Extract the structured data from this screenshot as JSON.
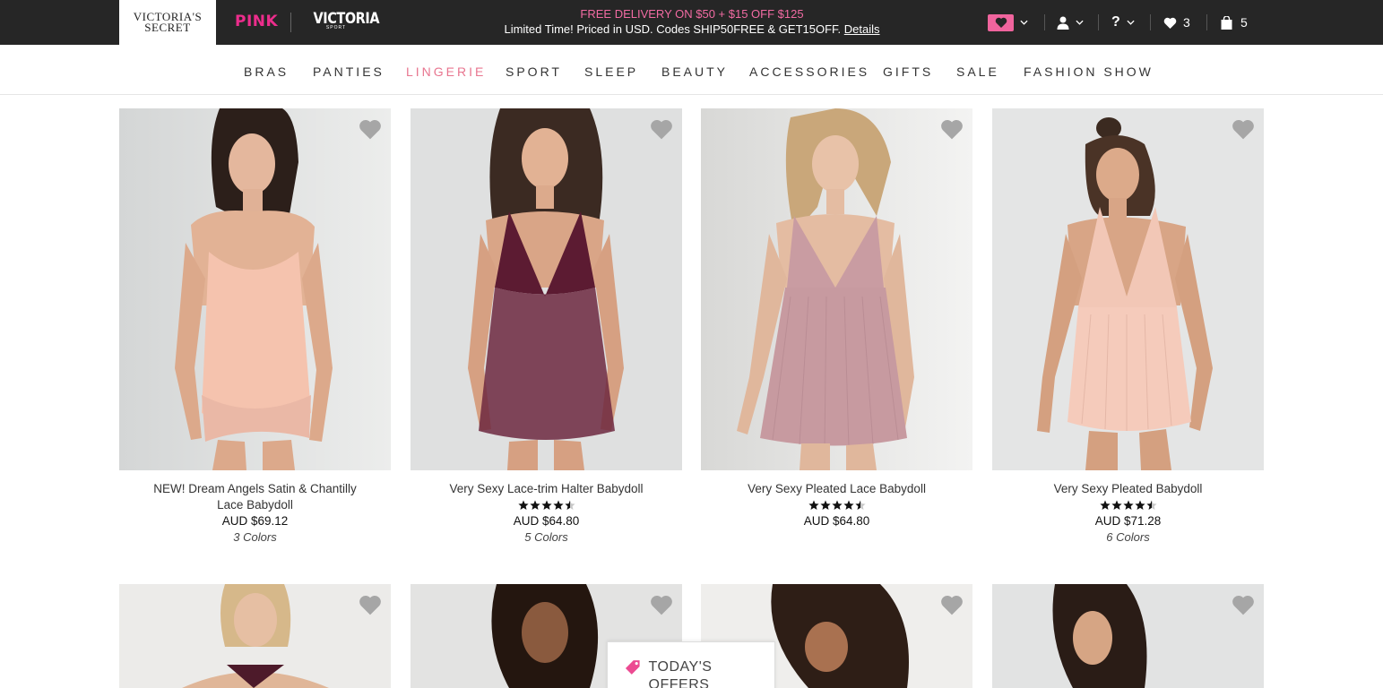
{
  "header": {
    "brand_vs_line1": "VICTORIA'S",
    "brand_vs_line2": "SECRET",
    "brand_pink": "PINK",
    "brand_sport_main": "VICTORIA",
    "brand_sport_sub": "SPORT",
    "promo_line1": "FREE DELIVERY ON $50 + $15 OFF $125",
    "promo_line2": "Limited Time! Priced in USD. Codes SHIP50FREE & GET15OFF.",
    "promo_details": "Details",
    "wishlist_count": "3",
    "bag_count": "5",
    "help_label": "?"
  },
  "nav": {
    "items": [
      "BRAS",
      "PANTIES",
      "LINGERIE",
      "SPORT",
      "SLEEP",
      "BEAUTY",
      "ACCESSORIES",
      "GIFTS",
      "SALE",
      "FASHION SHOW"
    ],
    "active": "LINGERIE"
  },
  "products": [
    {
      "name_line1": "NEW! Dream Angels Satin & Chantilly",
      "name_line2": "Lace Babydoll",
      "rating": 0,
      "price": "AUD $69.12",
      "colors": "3 Colors"
    },
    {
      "name_line1": "Very Sexy Lace-trim Halter Babydoll",
      "name_line2": "",
      "rating": 4.5,
      "price": "AUD $64.80",
      "colors": "5 Colors"
    },
    {
      "name_line1": "Very Sexy Pleated Lace Babydoll",
      "name_line2": "",
      "rating": 4.5,
      "price": "AUD $64.80",
      "colors": ""
    },
    {
      "name_line1": "Very Sexy Pleated Babydoll",
      "name_line2": "",
      "rating": 4.5,
      "price": "AUD $71.28",
      "colors": "6 Colors"
    }
  ],
  "offers": {
    "label": "TODAY'S OFFERS"
  },
  "colors": {
    "topbar_bg": "#262626",
    "pink_accent": "#ec2d8c",
    "promo_pink": "#f26ba3",
    "nav_active": "#e8758f",
    "heart_gray": "#a6a6a6"
  }
}
